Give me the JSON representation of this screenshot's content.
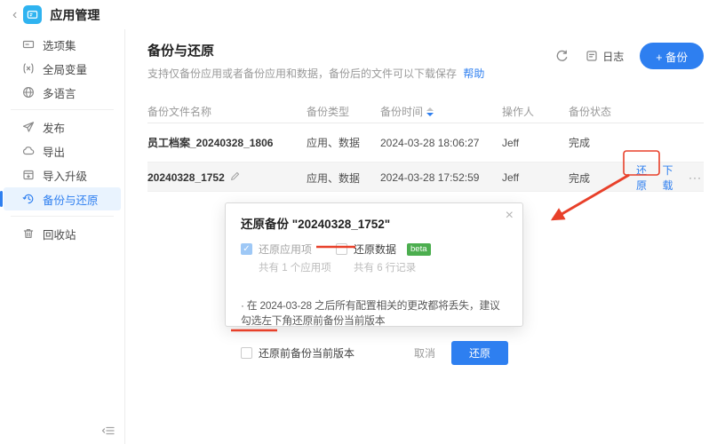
{
  "topbar": {
    "app_title": "应用管理"
  },
  "sidebar": {
    "group1": [
      {
        "label": "选项集"
      },
      {
        "label": "全局变量"
      },
      {
        "label": "多语言"
      }
    ],
    "group2": [
      {
        "label": "发布"
      },
      {
        "label": "导出"
      },
      {
        "label": "导入升级"
      },
      {
        "label": "备份与还原"
      }
    ],
    "group3": [
      {
        "label": "回收站"
      }
    ]
  },
  "main": {
    "title": "备份与还原",
    "subtitle": "支持仅备份应用或者备份应用和数据，备份后的文件可以下载保存",
    "help_link": "帮助",
    "toolbar": {
      "log_label": "日志",
      "backup_button_label": "+ 备份"
    },
    "table": {
      "headers": [
        "备份文件名称",
        "备份类型",
        "备份时间",
        "操作人",
        "备份状态"
      ],
      "rows": [
        {
          "name": "员工档案_20240328_1806",
          "type": "应用、数据",
          "time": "2024-03-28 18:06:27",
          "operator": "Jeff",
          "status": "完成"
        },
        {
          "name": "20240328_1752",
          "type": "应用、数据",
          "time": "2024-03-28 17:52:59",
          "operator": "Jeff",
          "status": "完成",
          "actions": [
            "还原",
            "下载",
            "···"
          ]
        }
      ]
    }
  },
  "modal": {
    "title": "还原备份 \"20240328_1752\"",
    "close_icon": "×",
    "option_app": {
      "label": "还原应用项",
      "sub": "共有 1 个应用项",
      "checked": true
    },
    "option_data": {
      "label": "还原数据",
      "badge": "beta",
      "sub": "共有 6 行记录",
      "checked": false
    },
    "notice": "· 在 2024-03-28 之后所有配置相关的更改都将丢失，建议勾选左下角还原前备份当前版本",
    "footer_checkbox_label": "还原前备份当前版本",
    "cancel_label": "取消",
    "confirm_label": "还原"
  },
  "colors": {
    "accent": "#2e7ff0",
    "accent_bg": "#e9f3fe",
    "annotation_red": "#e8402a",
    "beta_green": "#4cae4f",
    "app_icon_blue": "#2fb3f0",
    "row_alt_bg": "#f5f5f5"
  }
}
